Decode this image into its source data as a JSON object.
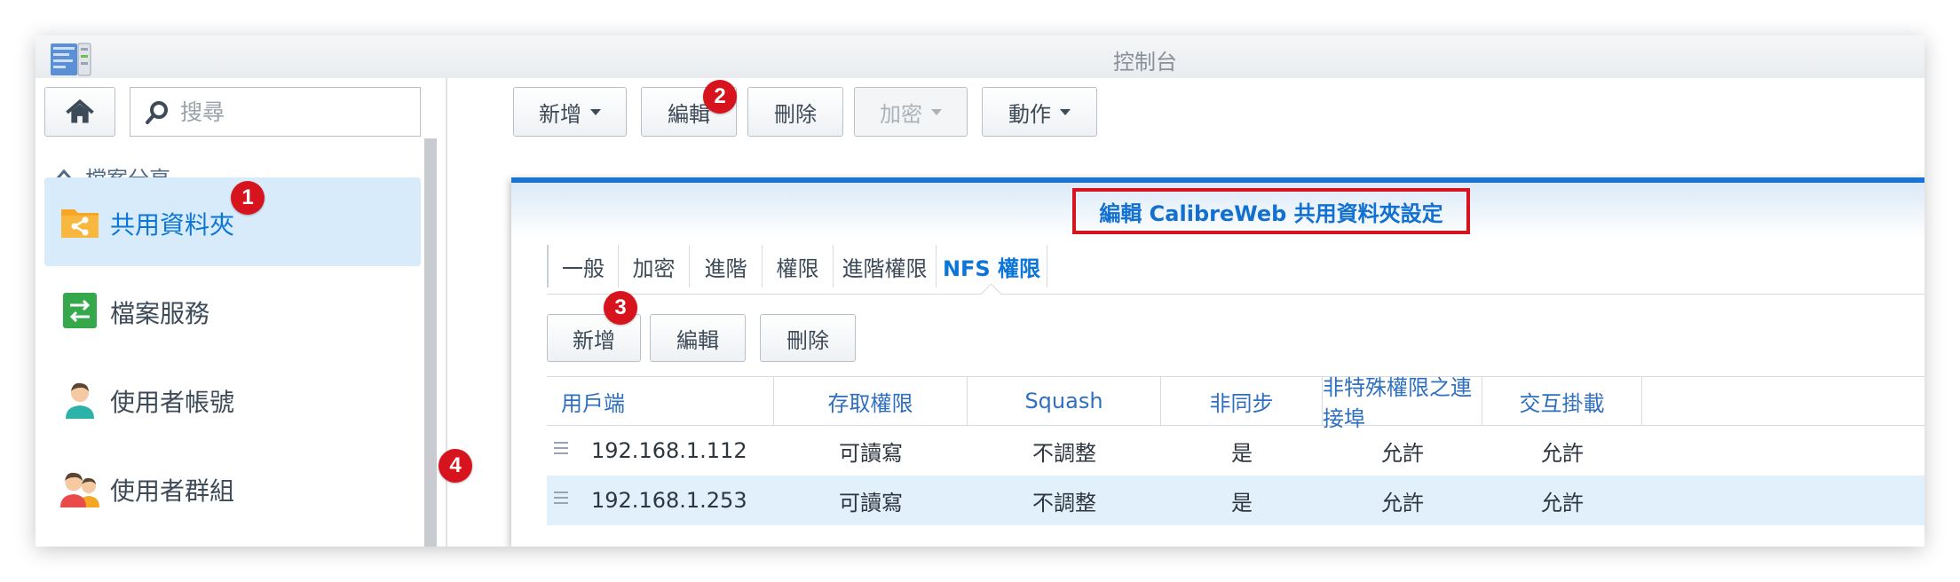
{
  "window": {
    "title": "控制台"
  },
  "sidebar": {
    "search_placeholder": "搜尋",
    "section_label": "檔案分享",
    "items": [
      {
        "label": "共用資料夾",
        "icon": "shared-folder-icon",
        "active": true
      },
      {
        "label": "檔案服務",
        "icon": "file-services-icon",
        "active": false
      },
      {
        "label": "使用者帳號",
        "icon": "user-icon",
        "active": false
      },
      {
        "label": "使用者群組",
        "icon": "group-icon",
        "active": false
      }
    ]
  },
  "toolbar": {
    "buttons": [
      {
        "label": "新增",
        "dropdown": true,
        "disabled": false
      },
      {
        "label": "編輯",
        "dropdown": false,
        "disabled": false
      },
      {
        "label": "刪除",
        "dropdown": false,
        "disabled": false
      },
      {
        "label": "加密",
        "dropdown": true,
        "disabled": true
      },
      {
        "label": "動作",
        "dropdown": true,
        "disabled": false
      }
    ]
  },
  "dialog": {
    "title": "編輯 CalibreWeb 共用資料夾設定",
    "tabs": [
      "一般",
      "加密",
      "進階",
      "權限",
      "進階權限",
      "NFS 權限"
    ],
    "active_tab": "NFS 權限",
    "buttons": [
      "新增",
      "編輯",
      "刪除"
    ],
    "columns": [
      "用戶端",
      "存取權限",
      "Squash",
      "非同步",
      "非特殊權限之連接埠",
      "交互掛載"
    ],
    "rows": [
      [
        "192.168.1.112",
        "可讀寫",
        "不調整",
        "是",
        "允許",
        "允許"
      ],
      [
        "192.168.1.253",
        "可讀寫",
        "不調整",
        "是",
        "允許",
        "允許"
      ]
    ],
    "selected_row": 1
  },
  "annotations": [
    "1",
    "2",
    "3",
    "4"
  ],
  "colors": {
    "accent": "#0c75d8",
    "highlight": "#d7131e",
    "selected_bg": "#e2f0fb"
  }
}
